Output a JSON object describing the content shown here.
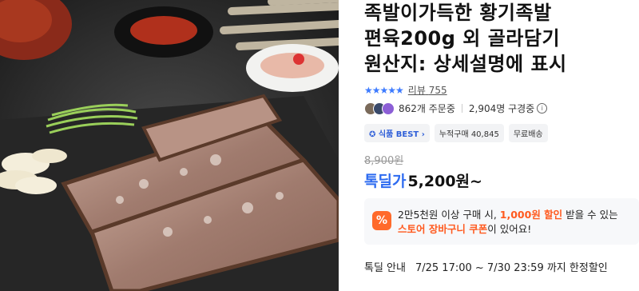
{
  "product": {
    "title_lines": [
      "족발이가득한 황기족발",
      "편육200g 외 골라담기",
      "원산지: 상세설명에 표시"
    ]
  },
  "rating": {
    "stars": "★★★★★",
    "review_label": "리뷰",
    "review_count": "755"
  },
  "stats": {
    "orders": "862개 주문중",
    "watchers": "2,904명 구경중",
    "info_icon": "info-icon"
  },
  "badges": {
    "best": "식품 BEST",
    "best_icon": "✪",
    "cumulative": "누적구매 40,845",
    "shipping": "무료배송"
  },
  "pricing": {
    "original": "8,900원",
    "deal_label": "톡딜가",
    "deal_price": "5,200원~"
  },
  "coupon": {
    "icon": "%",
    "line1_pre": "2만5천원 이상 구매 시, ",
    "line1_highlight": "1,000원 할인",
    "line1_post": " 받을 수 있는",
    "line2_highlight": "스토어 장바구니 쿠폰",
    "line2_post": "이 있어요!"
  },
  "notice": {
    "label": "톡딜 안내",
    "period": "7/25 17:00 ~ 7/30 23:59 까지 한정할인"
  },
  "colors": {
    "accent_blue": "#2d6bf0",
    "coupon_orange": "#ff5a1f"
  }
}
